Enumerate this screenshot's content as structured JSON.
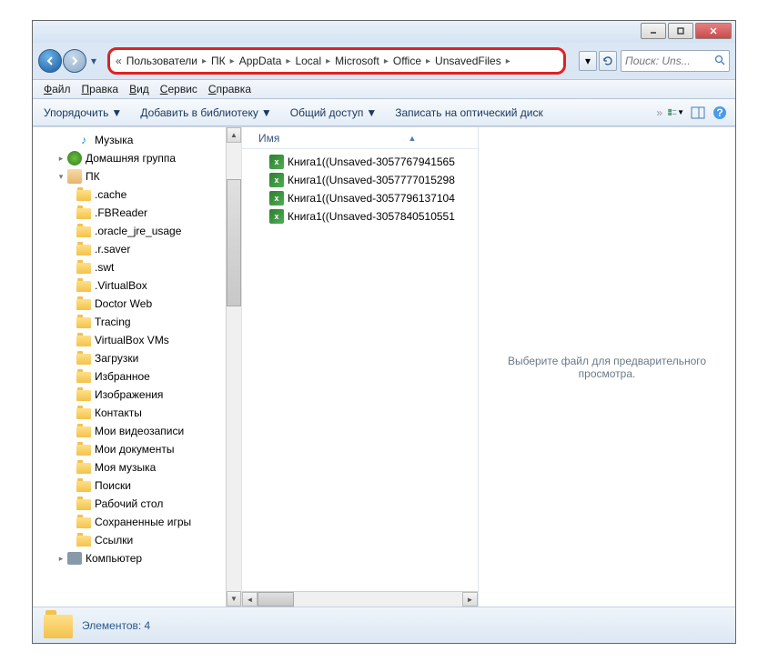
{
  "breadcrumbs": [
    "Пользователи",
    "ПК",
    "AppData",
    "Local",
    "Microsoft",
    "Office",
    "UnsavedFiles"
  ],
  "search": {
    "placeholder": "Поиск: Uns..."
  },
  "menu": {
    "file": "Файл",
    "edit": "Правка",
    "view": "Вид",
    "tools": "Сервис",
    "help": "Справка"
  },
  "toolbar": {
    "organize": "Упорядочить",
    "add_library": "Добавить в библиотеку",
    "share": "Общий доступ",
    "burn": "Записать на оптический диск"
  },
  "sidebar": {
    "items": [
      {
        "label": "Музыка",
        "type": "music",
        "indent": 1
      },
      {
        "label": "Домашняя группа",
        "type": "group",
        "indent": 0,
        "expander": "▸"
      },
      {
        "label": "ПК",
        "type": "user",
        "indent": 0,
        "expander": "▾"
      },
      {
        "label": ".cache",
        "type": "folder",
        "indent": 1
      },
      {
        "label": ".FBReader",
        "type": "folder",
        "indent": 1
      },
      {
        "label": ".oracle_jre_usage",
        "type": "folder",
        "indent": 1
      },
      {
        "label": ".r.saver",
        "type": "folder",
        "indent": 1
      },
      {
        "label": ".swt",
        "type": "folder",
        "indent": 1
      },
      {
        "label": ".VirtualBox",
        "type": "folder",
        "indent": 1
      },
      {
        "label": "Doctor Web",
        "type": "folder",
        "indent": 1
      },
      {
        "label": "Tracing",
        "type": "folder",
        "indent": 1
      },
      {
        "label": "VirtualBox VMs",
        "type": "folder",
        "indent": 1
      },
      {
        "label": "Загрузки",
        "type": "folder",
        "indent": 1
      },
      {
        "label": "Избранное",
        "type": "folder",
        "indent": 1
      },
      {
        "label": "Изображения",
        "type": "folder",
        "indent": 1
      },
      {
        "label": "Контакты",
        "type": "folder",
        "indent": 1
      },
      {
        "label": "Мои видеозаписи",
        "type": "folder",
        "indent": 1
      },
      {
        "label": "Мои документы",
        "type": "folder",
        "indent": 1
      },
      {
        "label": "Моя музыка",
        "type": "folder",
        "indent": 1
      },
      {
        "label": "Поиски",
        "type": "folder",
        "indent": 1
      },
      {
        "label": "Рабочий стол",
        "type": "folder",
        "indent": 1
      },
      {
        "label": "Сохраненные игры",
        "type": "folder",
        "indent": 1
      },
      {
        "label": "Ссылки",
        "type": "folder",
        "indent": 1
      },
      {
        "label": "Компьютер",
        "type": "computer",
        "indent": 0,
        "expander": "▸"
      }
    ]
  },
  "content": {
    "column_name": "Имя",
    "files": [
      "Книга1((Unsaved-3057767941565",
      "Книга1((Unsaved-3057777015298",
      "Книга1((Unsaved-3057796137104",
      "Книга1((Unsaved-3057840510551"
    ]
  },
  "preview": {
    "text": "Выберите файл для предварительного просмотра."
  },
  "status": {
    "text": "Элементов: 4"
  }
}
